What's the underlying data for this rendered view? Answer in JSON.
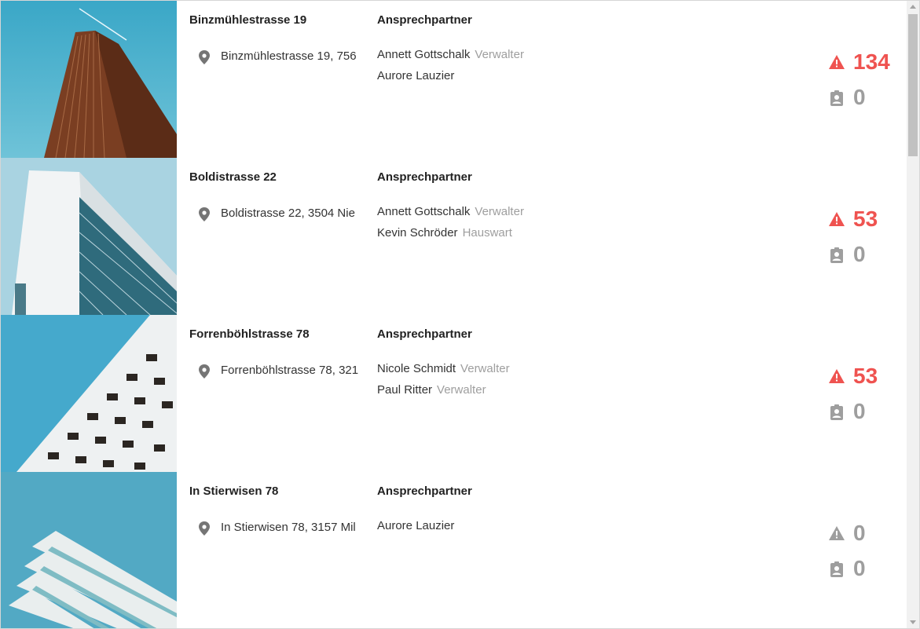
{
  "contacts_header": "Ansprechpartner",
  "colors": {
    "alert": "#ef5350",
    "muted": "#9e9e9e"
  },
  "properties": [
    {
      "title": "Binzmühlestrasse 19",
      "address": "Binzmühlestrasse 19, 756",
      "contacts": [
        {
          "name": "Annett Gottschalk",
          "role": "Verwalter"
        },
        {
          "name": "Aurore Lauzier",
          "role": ""
        }
      ],
      "alerts": "134",
      "tasks": "0"
    },
    {
      "title": "Boldistrasse 22",
      "address": "Boldistrasse 22, 3504 Nie",
      "contacts": [
        {
          "name": "Annett Gottschalk",
          "role": "Verwalter"
        },
        {
          "name": "Kevin Schröder",
          "role": "Hauswart"
        }
      ],
      "alerts": "53",
      "tasks": "0"
    },
    {
      "title": "Forrenböhlstrasse 78",
      "address": "Forrenböhlstrasse 78, 321",
      "contacts": [
        {
          "name": "Nicole Schmidt",
          "role": "Verwalter"
        },
        {
          "name": "Paul Ritter",
          "role": "Verwalter"
        }
      ],
      "alerts": "53",
      "tasks": "0"
    },
    {
      "title": "In Stierwisen 78",
      "address": "In Stierwisen 78, 3157 Mil",
      "contacts": [
        {
          "name": "Aurore Lauzier",
          "role": ""
        }
      ],
      "alerts": "0",
      "tasks": "0"
    }
  ]
}
